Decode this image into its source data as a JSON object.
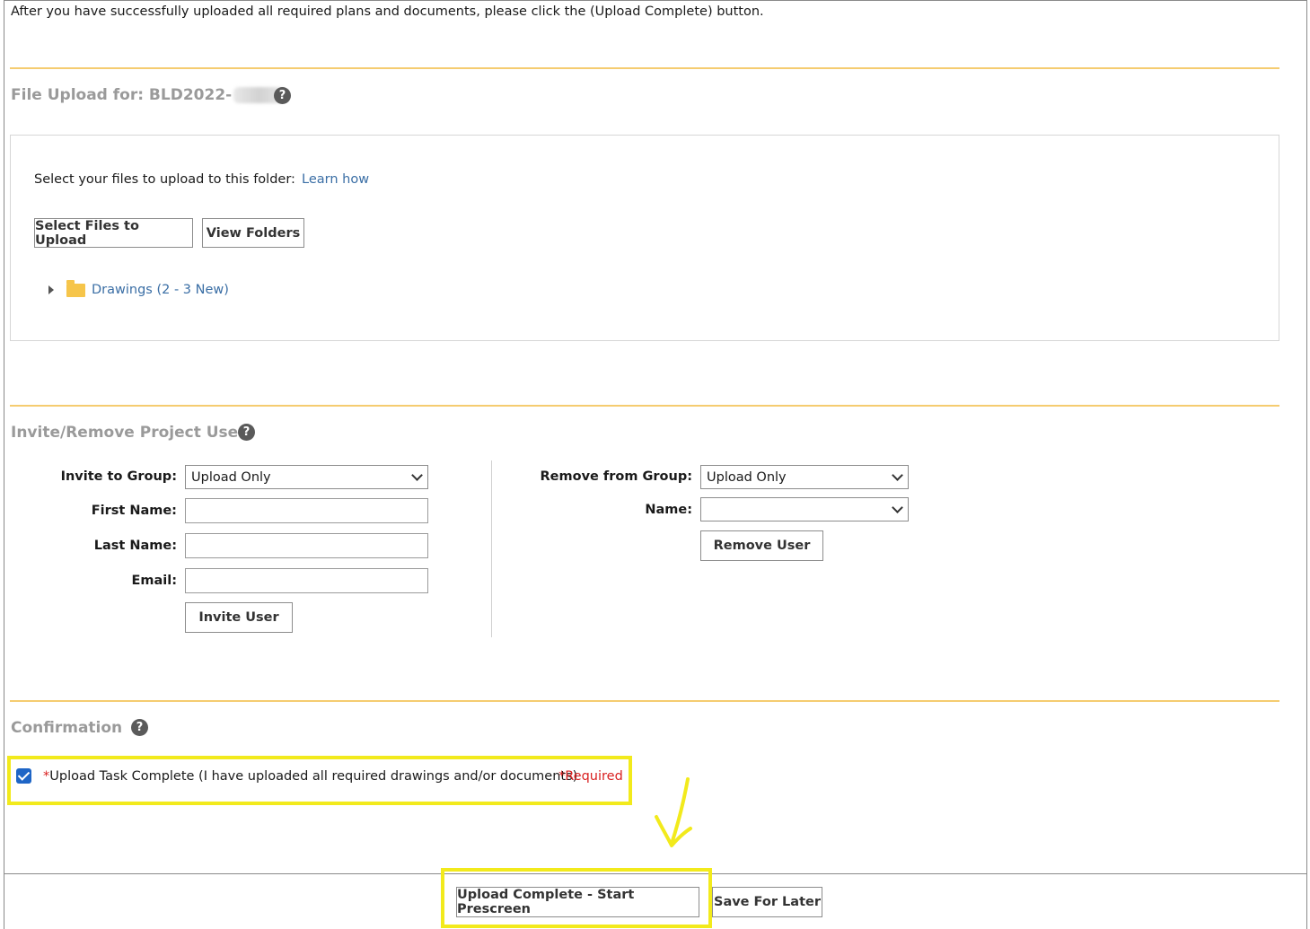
{
  "intro_text": "After you have successfully uploaded all required plans and documents, please click the (Upload Complete) button.",
  "file_upload": {
    "title": "File Upload for: BLD2022-",
    "help_icon": "?",
    "select_label": "Select your files to upload to this folder:",
    "learn_link": "Learn how",
    "select_button": "Select Files to Upload",
    "view_button": "View Folders",
    "folder_label": "Drawings (2 - 3 New)"
  },
  "invite_section": {
    "title": "Invite/Remove Project User",
    "help_icon": "?",
    "invite_group_label": "Invite to Group:",
    "invite_group_value": "Upload Only",
    "first_name_label": "First Name:",
    "last_name_label": "Last Name:",
    "email_label": "Email:",
    "invite_button": "Invite User",
    "remove_group_label": "Remove from Group:",
    "remove_group_value": "Upload Only",
    "name_label": "Name:",
    "name_value": "",
    "remove_button": "Remove User"
  },
  "confirmation": {
    "title": "Confirmation",
    "help_icon": "?",
    "checked": true,
    "star": "*",
    "checkbox_label": "Upload Task Complete (I have uploaded all required drawings and/or documents)",
    "required_text": "*Required"
  },
  "footer": {
    "upload_complete_button": "Upload Complete - Start Prescreen",
    "save_later_button": "Save For Later"
  },
  "colors": {
    "divider": "#f5cc70",
    "highlight": "#f2ea1c",
    "link": "#3a6ea5",
    "required": "#d92020",
    "checkbox": "#1e65c6"
  }
}
